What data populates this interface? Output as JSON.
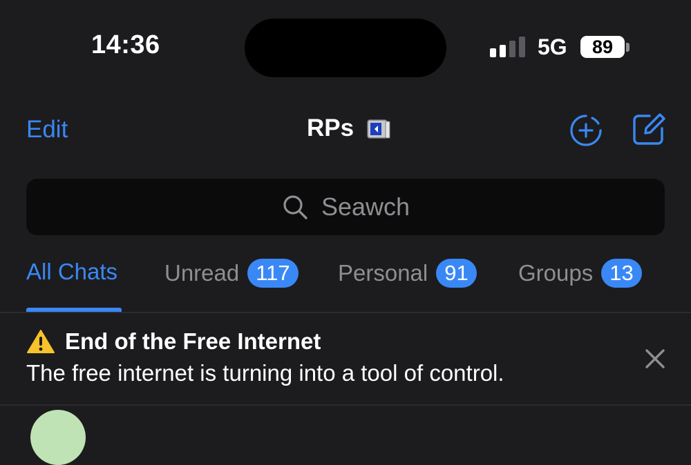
{
  "status_bar": {
    "time": "14:36",
    "network": "5G",
    "battery": "89",
    "signal_bars_filled": 2,
    "signal_bars_total": 4
  },
  "nav": {
    "edit_label": "Edit",
    "title": "RPs",
    "title_icon": "folder-emoji-icon",
    "add_story_icon": "add-story-icon",
    "compose_icon": "compose-icon"
  },
  "search": {
    "placeholder": "Seawch",
    "icon": "search-icon"
  },
  "tabs": [
    {
      "label": "All Chats",
      "badge": ""
    },
    {
      "label": "Unread",
      "badge": "117"
    },
    {
      "label": "Personal",
      "badge": "91"
    },
    {
      "label": "Groups",
      "badge": "13"
    }
  ],
  "banner": {
    "icon": "warning-icon",
    "title": "End of the Free Internet",
    "text": "The free internet is turning into a tool of control."
  },
  "colors": {
    "accent": "#3a88f5",
    "background": "#1c1c1e",
    "secondary_text": "#8e8e93"
  }
}
